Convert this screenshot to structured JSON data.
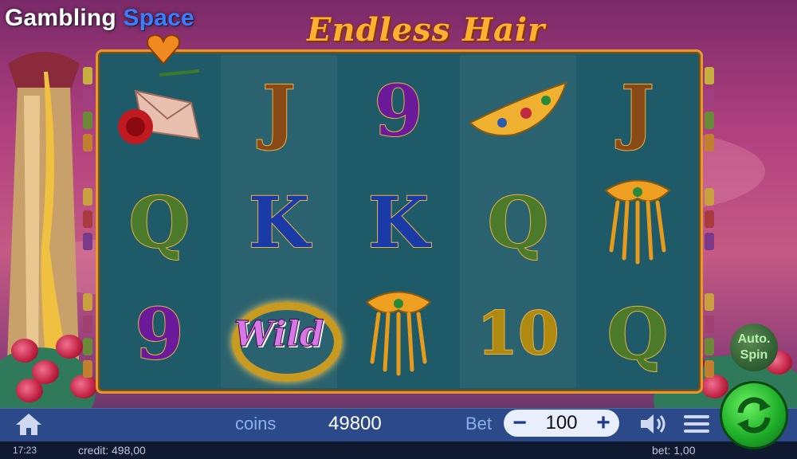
{
  "brand": {
    "part1": "Gambling ",
    "part2": "Space"
  },
  "game": {
    "title": "Endless Hair"
  },
  "reels": [
    [
      "love-letter-rose",
      "Q",
      "9"
    ],
    [
      "J",
      "K",
      "Wild"
    ],
    [
      "9",
      "K",
      "hair-comb"
    ],
    [
      "tiara",
      "Q",
      "10"
    ],
    [
      "J",
      "hair-comb",
      "Q"
    ]
  ],
  "symbol_colors": {
    "J": "#8a4a18",
    "Q": "#4a7a2a",
    "K": "#1a3aa8",
    "9": "#6a1a9a",
    "10": "#b08a10"
  },
  "controls": {
    "coins_label": "coins",
    "coins_value": "49800",
    "bet_label": "Bet",
    "bet_minus": "−",
    "bet_value": "100",
    "bet_plus": "+",
    "auto_line1": "Auto.",
    "auto_line2": "Spin"
  },
  "status": {
    "time": "17:23",
    "credit": "credit: 498,00",
    "bet": "bet: 1,00"
  },
  "icons": {
    "home": "home-icon",
    "sound": "speaker-icon",
    "menu": "hamburger-menu-icon",
    "spin": "spin-arrows-icon"
  }
}
